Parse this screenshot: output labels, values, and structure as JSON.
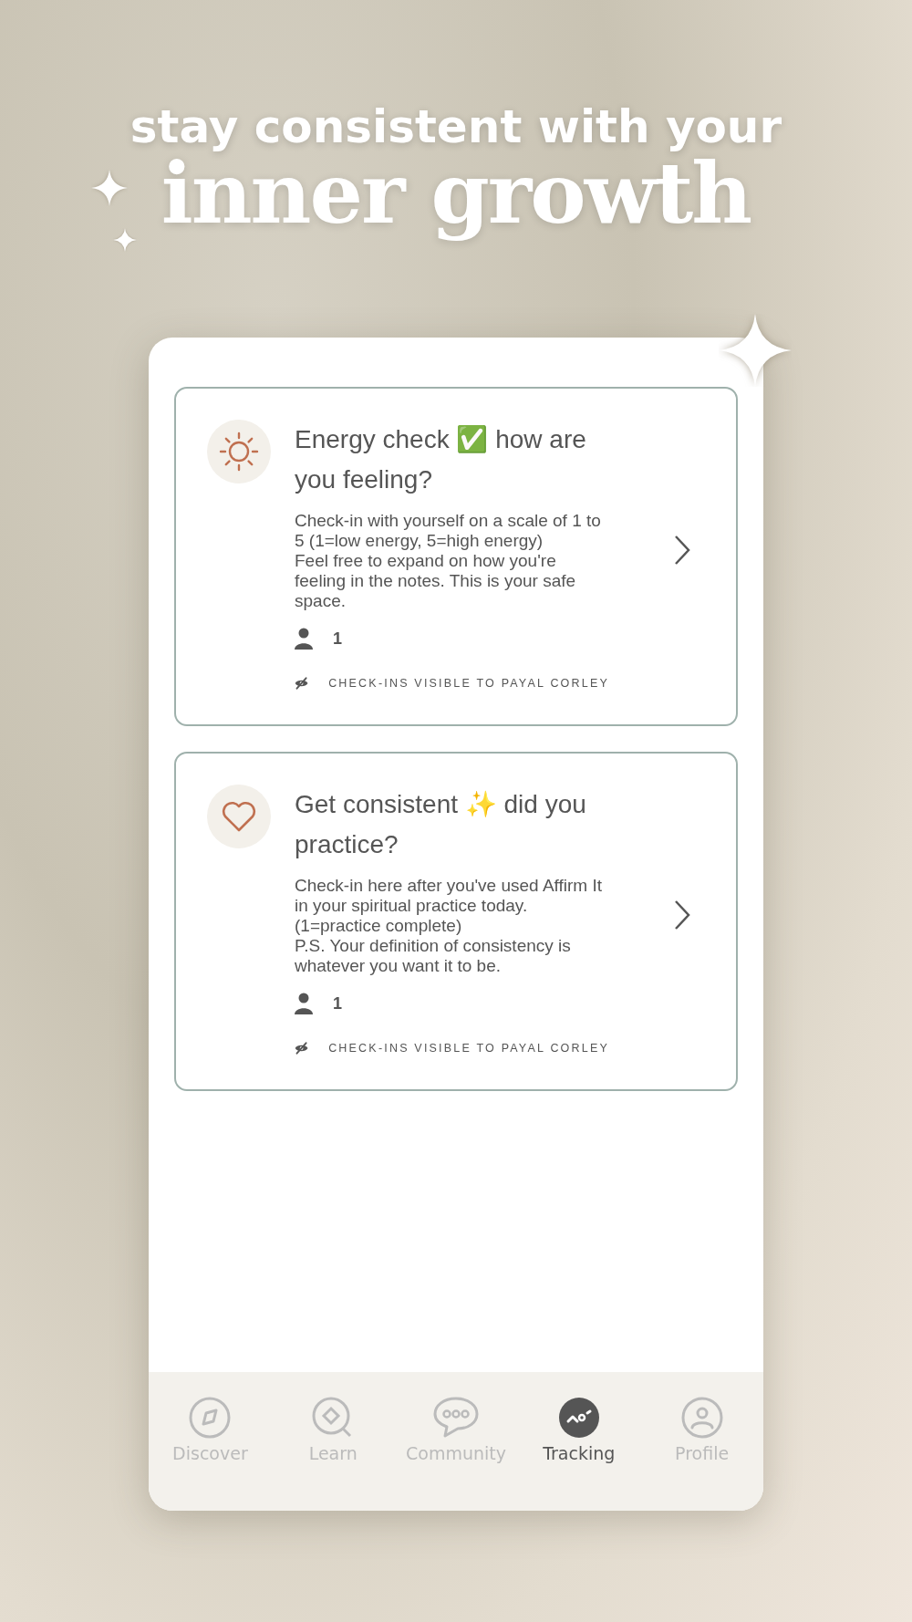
{
  "headline": {
    "line_1": "stay consistent with your",
    "line_2": "inner growth"
  },
  "cards": [
    {
      "kind": "sun",
      "title": "Energy check ✅ how are you feeling?",
      "description": "Check-in with yourself on a scale of 1 to 5 (1=low energy, 5=high energy)\nFeel free to expand on how you're feeling in the notes. This is your safe space.",
      "members": "1",
      "visibility": "CHECK-INS VISIBLE TO PAYAL CORLEY"
    },
    {
      "kind": "heart",
      "title": "Get consistent ✨ did you practice?",
      "description": "Check-in here after you've used Affirm It in your spiritual practice today. (1=practice complete)\nP.S. Your definition of consistency is whatever you want it to be.",
      "members": "1",
      "visibility": "CHECK-INS VISIBLE TO PAYAL CORLEY"
    }
  ],
  "tabs": [
    {
      "kind": "compass",
      "label": "Discover",
      "selected": false
    },
    {
      "kind": "learn",
      "label": "Learn",
      "selected": false
    },
    {
      "kind": "chat",
      "label": "Community",
      "selected": false
    },
    {
      "kind": "tracking",
      "label": "Tracking",
      "selected": true
    },
    {
      "kind": "profile",
      "label": "Profile",
      "selected": false
    }
  ]
}
